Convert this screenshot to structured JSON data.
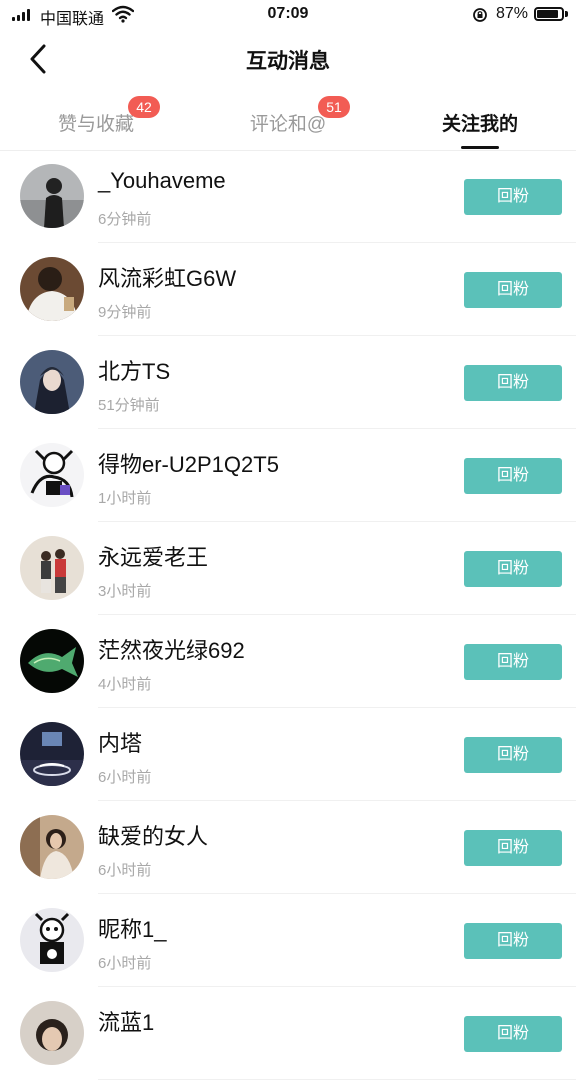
{
  "status_bar": {
    "carrier": "中国联通",
    "time": "07:09",
    "battery_percent": "87%",
    "battery_level": 0.87
  },
  "header": {
    "title": "互动消息",
    "back_icon": "chevron-left-icon"
  },
  "tabs": [
    {
      "label": "赞与收藏",
      "badge": "42",
      "active": false
    },
    {
      "label": "评论和@",
      "badge": "51",
      "active": false
    },
    {
      "label": "关注我的",
      "badge": "",
      "active": true
    }
  ],
  "colors": {
    "accent": "#5bc1b9",
    "badge": "#f25c54",
    "subtext": "#a8a8a8"
  },
  "follow_button_label": "回粉",
  "list": [
    {
      "name": "_Youhaveme",
      "time": "6分钟前",
      "avatar": "avatar-silhouette"
    },
    {
      "name": "风流彩虹G6W",
      "time": "9分钟前",
      "avatar": "avatar-person-white-hoodie"
    },
    {
      "name": "北方TS",
      "time": "51分钟前",
      "avatar": "avatar-anime-character"
    },
    {
      "name": "得物er-U2P1Q2T5",
      "time": "1小时前",
      "avatar": "avatar-cartoon-sketch"
    },
    {
      "name": "永远爱老王",
      "time": "3小时前",
      "avatar": "avatar-two-people"
    },
    {
      "name": "茫然夜光绿692",
      "time": "4小时前",
      "avatar": "avatar-green-fish"
    },
    {
      "name": "内塔",
      "time": "6小时前",
      "avatar": "avatar-basketball-court"
    },
    {
      "name": "缺爱的女人",
      "time": "6小时前",
      "avatar": "avatar-woman-photo"
    },
    {
      "name": "昵称1_",
      "time": "6小时前",
      "avatar": "avatar-cartoon-character"
    },
    {
      "name": "流蓝1",
      "time": "",
      "avatar": "avatar-person-partial"
    }
  ]
}
